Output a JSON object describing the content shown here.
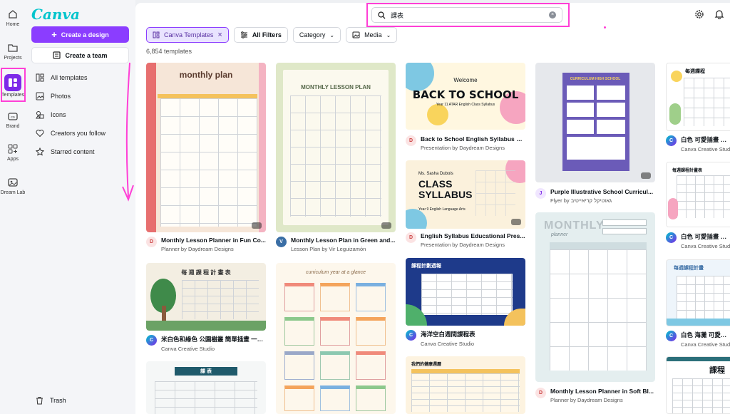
{
  "rail": {
    "items": [
      {
        "label": "Home",
        "icon": "home-icon"
      },
      {
        "label": "Projects",
        "icon": "folder-icon"
      },
      {
        "label": "Templates",
        "icon": "templates-icon"
      },
      {
        "label": "Brand",
        "icon": "brand-icon"
      },
      {
        "label": "Apps",
        "icon": "apps-icon"
      },
      {
        "label": "Dream Lab",
        "icon": "dream-lab-icon"
      }
    ]
  },
  "panel": {
    "logo": "Canva",
    "create_design": "Create a design",
    "create_team": "Create a team",
    "nav": [
      {
        "label": "All templates",
        "icon": "template-icon"
      },
      {
        "label": "Photos",
        "icon": "photo-icon"
      },
      {
        "label": "Icons",
        "icon": "shapes-icon"
      },
      {
        "label": "Creators you follow",
        "icon": "heart-icon"
      },
      {
        "label": "Starred content",
        "icon": "star-icon"
      }
    ],
    "trash": "Trash"
  },
  "search": {
    "value": "課表"
  },
  "filters": {
    "selected_chip": "Canva Templates",
    "all_filters": "All Filters",
    "category": "Category",
    "media": "Media"
  },
  "result_count": "6,854 templates",
  "cards": [
    {
      "title": "Monthly Lesson Planner in Fun Co...",
      "sub": "Planner by Daydream Designs",
      "thumb_title": "monthly plan"
    },
    {
      "title": "Monthly Lesson Plan in Green and...",
      "sub": "Lesson Plan by Vir Leguizamón",
      "thumb_title": "MONTHLY LESSON PLAN"
    },
    {
      "title": "Back to School English Syllabus Pr...",
      "sub": "Presentation by Daydream Designs",
      "thumb_title": "BACK TO SCHOOL",
      "thumb_small": "Welcome",
      "thumb_sub": "Year 11 ATAR English Class Syllabus"
    },
    {
      "title": "English Syllabus Educational Pres...",
      "sub": "Presentation by Daydream Designs",
      "thumb_title": "CLASS SYLLABUS",
      "thumb_small": "Ms. Sasha Dubois",
      "thumb_sub": "Year 9 English Language Arts"
    },
    {
      "title": "Purple Illustrative School Curricul...",
      "sub": "Flyer by גאוטיקל קריאייטיב",
      "thumb_title": "CURRICULUM HIGH SCHOOL"
    },
    {
      "title": "米白色和綠色 公園樹叢 簡單插畫 一週...",
      "sub": "Canva Creative Studio",
      "thumb_title": "每 週 課 程 計 畫 表"
    },
    {
      "title": "curriculum year at a glance",
      "sub": "",
      "thumb_title": "curriculum year at a glance"
    },
    {
      "title": "海洋空白週間課程表",
      "sub": "Canva Creative Studio",
      "thumb_title": "課程計劃週報"
    },
    {
      "title": "Monthly Lesson Planner in Soft Bl...",
      "sub": "Planner by Daydream Designs",
      "thumb_title": "MONTHLY",
      "thumb_small": "planner"
    },
    {
      "title": "白色 可愛插畫 一週...",
      "sub": "Canva Creative Studio",
      "thumb_title": "每週課程"
    },
    {
      "title": "白色 可愛插畫 簡單...",
      "sub": "Canva Creative Studio",
      "thumb_title": "每週課程計畫表"
    },
    {
      "title": "白色 海灘 可愛插畫...",
      "sub": "Canva Creative Studio",
      "thumb_title": "每週課程計畫"
    },
    {
      "title": "課表",
      "sub": "",
      "thumb_title": "課 表"
    },
    {
      "title": "我們的健康週曆",
      "sub": "",
      "thumb_title": "我們的健康週曆"
    },
    {
      "title": "課程",
      "sub": "",
      "thumb_title": "課程"
    }
  ],
  "colors": {
    "accent": "#8b3dff",
    "highlight": "#ff3fd6",
    "logo": "#00c4cc"
  }
}
